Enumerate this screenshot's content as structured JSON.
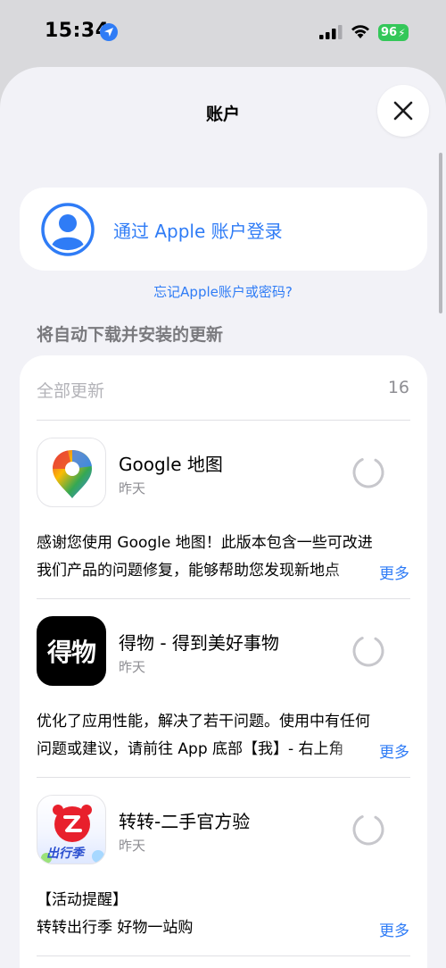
{
  "status_bar": {
    "time": "15:34",
    "battery": "96",
    "icons": [
      "location-icon",
      "signal-icon",
      "wifi-icon",
      "battery-icon"
    ]
  },
  "sheet": {
    "title": "账户",
    "close_icon": "close-icon"
  },
  "account": {
    "signin_label": "通过 Apple 账户登录",
    "forgot_link": "忘记Apple账户或密码?"
  },
  "updates": {
    "section_title": "将自动下载并安装的更新",
    "all_label": "全部更新",
    "count": "16",
    "apps": [
      {
        "name": "Google 地图",
        "date": "昨天",
        "notes": [
          "感谢您使用 Google 地图！此版本包含一些可改进",
          "我们产品的问题修复，能够帮助您发现新地点"
        ],
        "more": "更多"
      },
      {
        "name": "得物 - 得到美好事物",
        "date": "昨天",
        "icon_text": "得物",
        "notes": [
          "优化了应用性能，解决了若干问题。使用中有任何",
          "问题或建议，请前往 App 底部【我】- 右上角"
        ],
        "more": "更多"
      },
      {
        "name": "转转-二手官方验",
        "date": "昨天",
        "icon_text": "出行季",
        "notes": [
          "【活动提醒】",
          "转转出行季 好物一站购"
        ],
        "more": "更多"
      }
    ]
  },
  "colors": {
    "accent": "#2f7cf6",
    "battery": "#34c759",
    "sheet_bg": "#f2f2f7"
  }
}
